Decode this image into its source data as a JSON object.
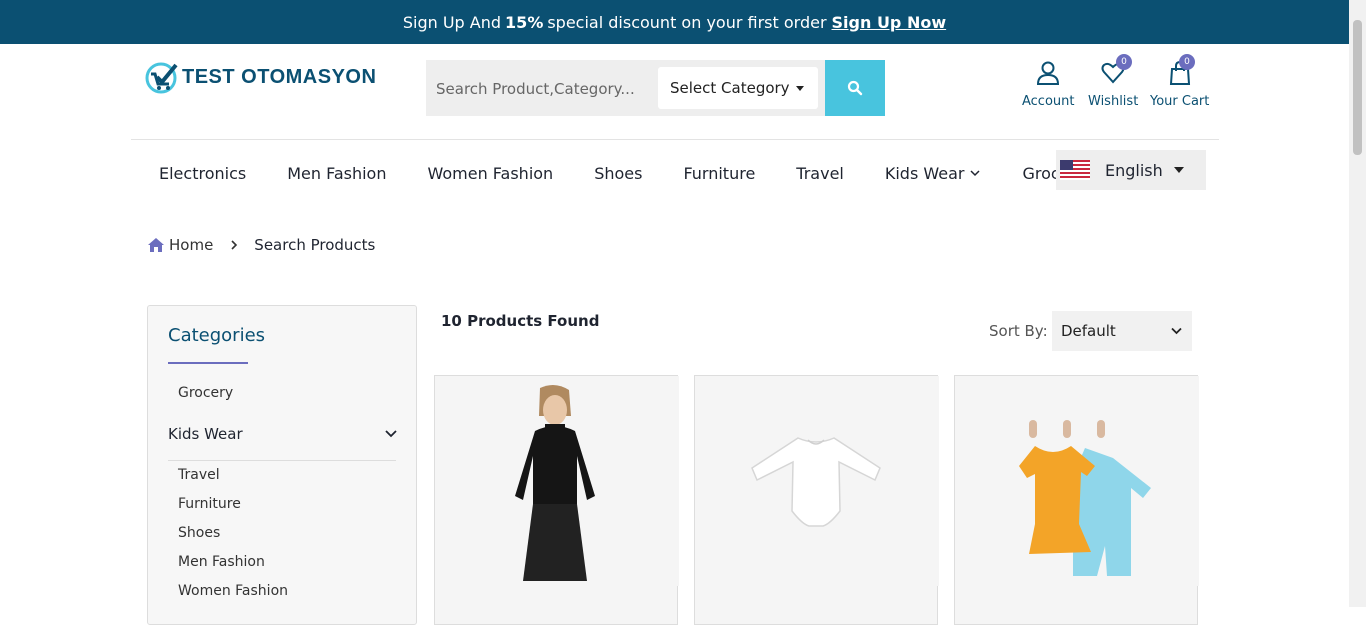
{
  "topbar": {
    "text_prefix": "Sign Up And",
    "discount": "15%",
    "text_suffix": "special discount on your first order",
    "link": "Sign Up Now"
  },
  "brand": {
    "name": "TEST OTOMASYON"
  },
  "search": {
    "placeholder": "Search Product,Category...",
    "category_label": "Select Category",
    "button_icon": "search-icon"
  },
  "header_actions": {
    "account": {
      "label": "Account",
      "icon": "user-icon"
    },
    "wishlist": {
      "label": "Wishlist",
      "icon": "heart-icon",
      "count": "0"
    },
    "cart": {
      "label": "Your Cart",
      "icon": "shopping-bag-icon",
      "count": "0"
    }
  },
  "nav": {
    "items": [
      "Electronics",
      "Men Fashion",
      "Women Fashion",
      "Shoes",
      "Furniture",
      "Travel",
      "Kids Wear",
      "Grocery"
    ]
  },
  "language": {
    "label": "English",
    "flag": "us-flag-icon"
  },
  "breadcrumb": {
    "home": "Home",
    "current": "Search Products"
  },
  "sidebar": {
    "title": "Categories",
    "items": [
      "Grocery",
      "Kids Wear",
      "Travel",
      "Furniture",
      "Shoes",
      "Men Fashion",
      "Women Fashion"
    ]
  },
  "results": {
    "found": "10 Products Found"
  },
  "sort": {
    "label": "Sort By:",
    "value": "Default"
  },
  "colors": {
    "topbar": "#0b5072",
    "accent": "#48c4de",
    "badge": "#6b6dbe",
    "brand_text": "#0b5072"
  }
}
